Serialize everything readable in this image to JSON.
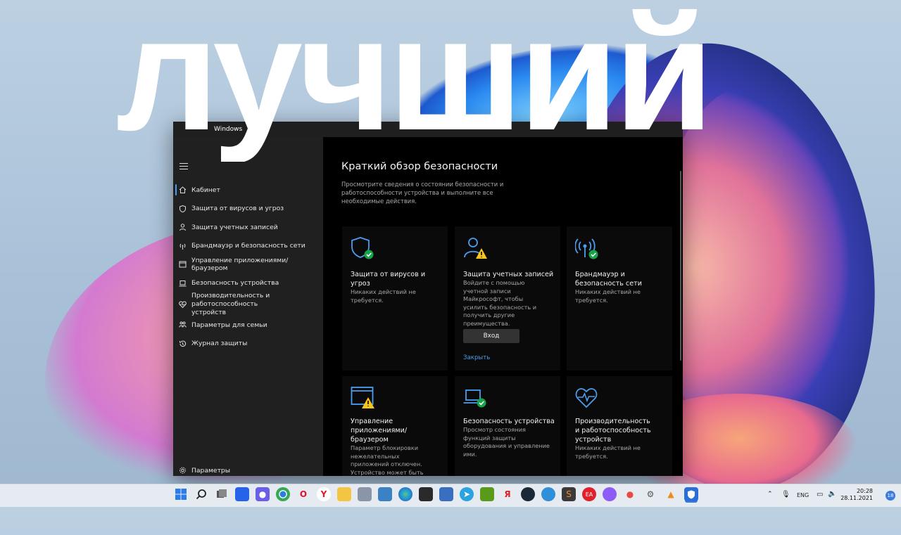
{
  "headline": "лучший",
  "window": {
    "title": "Windows"
  },
  "sidebar": {
    "items": [
      {
        "label": "Кабинет",
        "icon": "home-icon"
      },
      {
        "label": "Защита от вирусов и угроз",
        "icon": "shield-icon"
      },
      {
        "label": "Защита учетных записей",
        "icon": "person-icon"
      },
      {
        "label": "Брандмауэр и безопасность сети",
        "icon": "wifi-antenna-icon"
      },
      {
        "label": "Управление приложениями/браузером",
        "icon": "app-window-icon"
      },
      {
        "label": "Безопасность устройства",
        "icon": "laptop-icon"
      },
      {
        "label": "Производительность и работоспособность устройств",
        "icon": "heart-pulse-icon"
      },
      {
        "label": "Параметры для семьи",
        "icon": "family-icon"
      },
      {
        "label": "Журнал защиты",
        "icon": "history-icon"
      }
    ],
    "settings_label": "Параметры"
  },
  "main": {
    "title": "Краткий обзор безопасности",
    "description": "Просмотрите сведения о состоянии безопасности и работоспособности устройства и выполните все необходимые действия.",
    "cards": [
      {
        "title": "Защита от вирусов и угроз",
        "desc": "Никаких действий не требуется.",
        "status": "ok"
      },
      {
        "title": "Защита учетных записей",
        "desc": "Войдите с помощью учетной записи Майкрософт, чтобы усилить безопасность и получить другие преимущества.",
        "status": "warning",
        "button": "Вход",
        "link": "Закрыть"
      },
      {
        "title": "Брандмауэр и безопасность сети",
        "desc": "Никаких действий не требуется.",
        "status": "ok"
      },
      {
        "title": "Управление приложениями/браузером",
        "desc": "Параметр блокировки нежелательных приложений отключен. Устройство может быть уязвимым.",
        "status": "warning"
      },
      {
        "title": "Безопасность устройства",
        "desc": "Просмотр состояния функций защиты оборудования и управление ими.",
        "status": "ok"
      },
      {
        "title": "Производительность и работоспособность устройств",
        "desc": "Никаких действий не требуется.",
        "status": "none"
      }
    ]
  },
  "taskbar": {
    "lang": "ENG",
    "time": "20:28",
    "date": "28.11.2021",
    "notification_count": "18"
  },
  "colors": {
    "accent": "#4a9ef0",
    "ok": "#16a34a",
    "warning": "#f5c518"
  }
}
